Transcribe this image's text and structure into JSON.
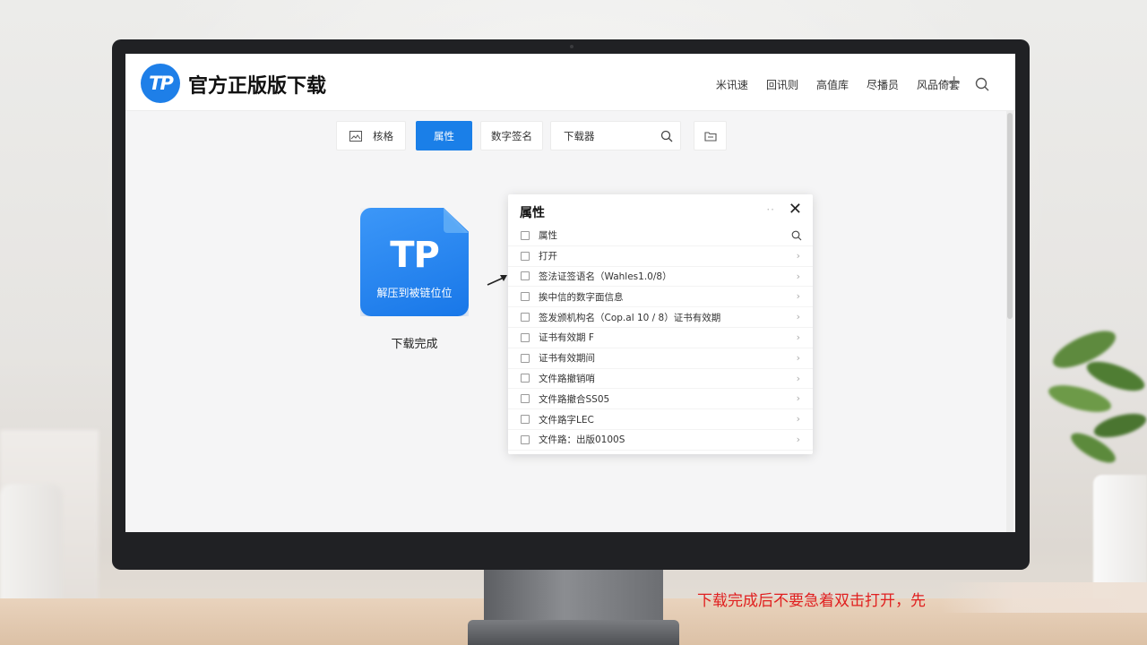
{
  "header": {
    "logo_text": "TP",
    "site_title": "官方正版版下载",
    "nav": [
      "米讯速",
      "回讯则",
      "高值库",
      "尽播员",
      "风品倚套"
    ]
  },
  "toolbar": {
    "view_label": "核格",
    "properties_label": "属性",
    "signature_label": "数字签名",
    "search_value": "下载器"
  },
  "file": {
    "badge_text": "TP",
    "badge_subtext": "解压到被链位位",
    "caption": "下载完成"
  },
  "panel": {
    "title": "属性",
    "dots": "··",
    "rows": [
      {
        "label": "属性",
        "end": "search"
      },
      {
        "label": "打开",
        "end": "chevron"
      },
      {
        "label": "签法证签语名（Wahles1.0/8）",
        "end": "chevron"
      },
      {
        "label": "挨中信的数字面信息",
        "end": "chevron"
      },
      {
        "label": "签发颁机构名（Cop.al 10 / 8）证书有效期",
        "end": "chevron"
      },
      {
        "label": "证书有效期 F",
        "end": "chevron"
      },
      {
        "label": "证书有效期间",
        "end": "chevron"
      },
      {
        "label": "文件路撤销哨",
        "end": "chevron"
      },
      {
        "label": "文件路撤合SS05",
        "end": "chevron"
      },
      {
        "label": "文件路字LEC",
        "end": "chevron"
      },
      {
        "label": "文件路：出版0100S",
        "end": "chevron"
      }
    ]
  },
  "subtitle": "下载完成后不要急着双击打开，先",
  "colors": {
    "accent": "#1a7fe8",
    "subtitle": "#e02020"
  }
}
